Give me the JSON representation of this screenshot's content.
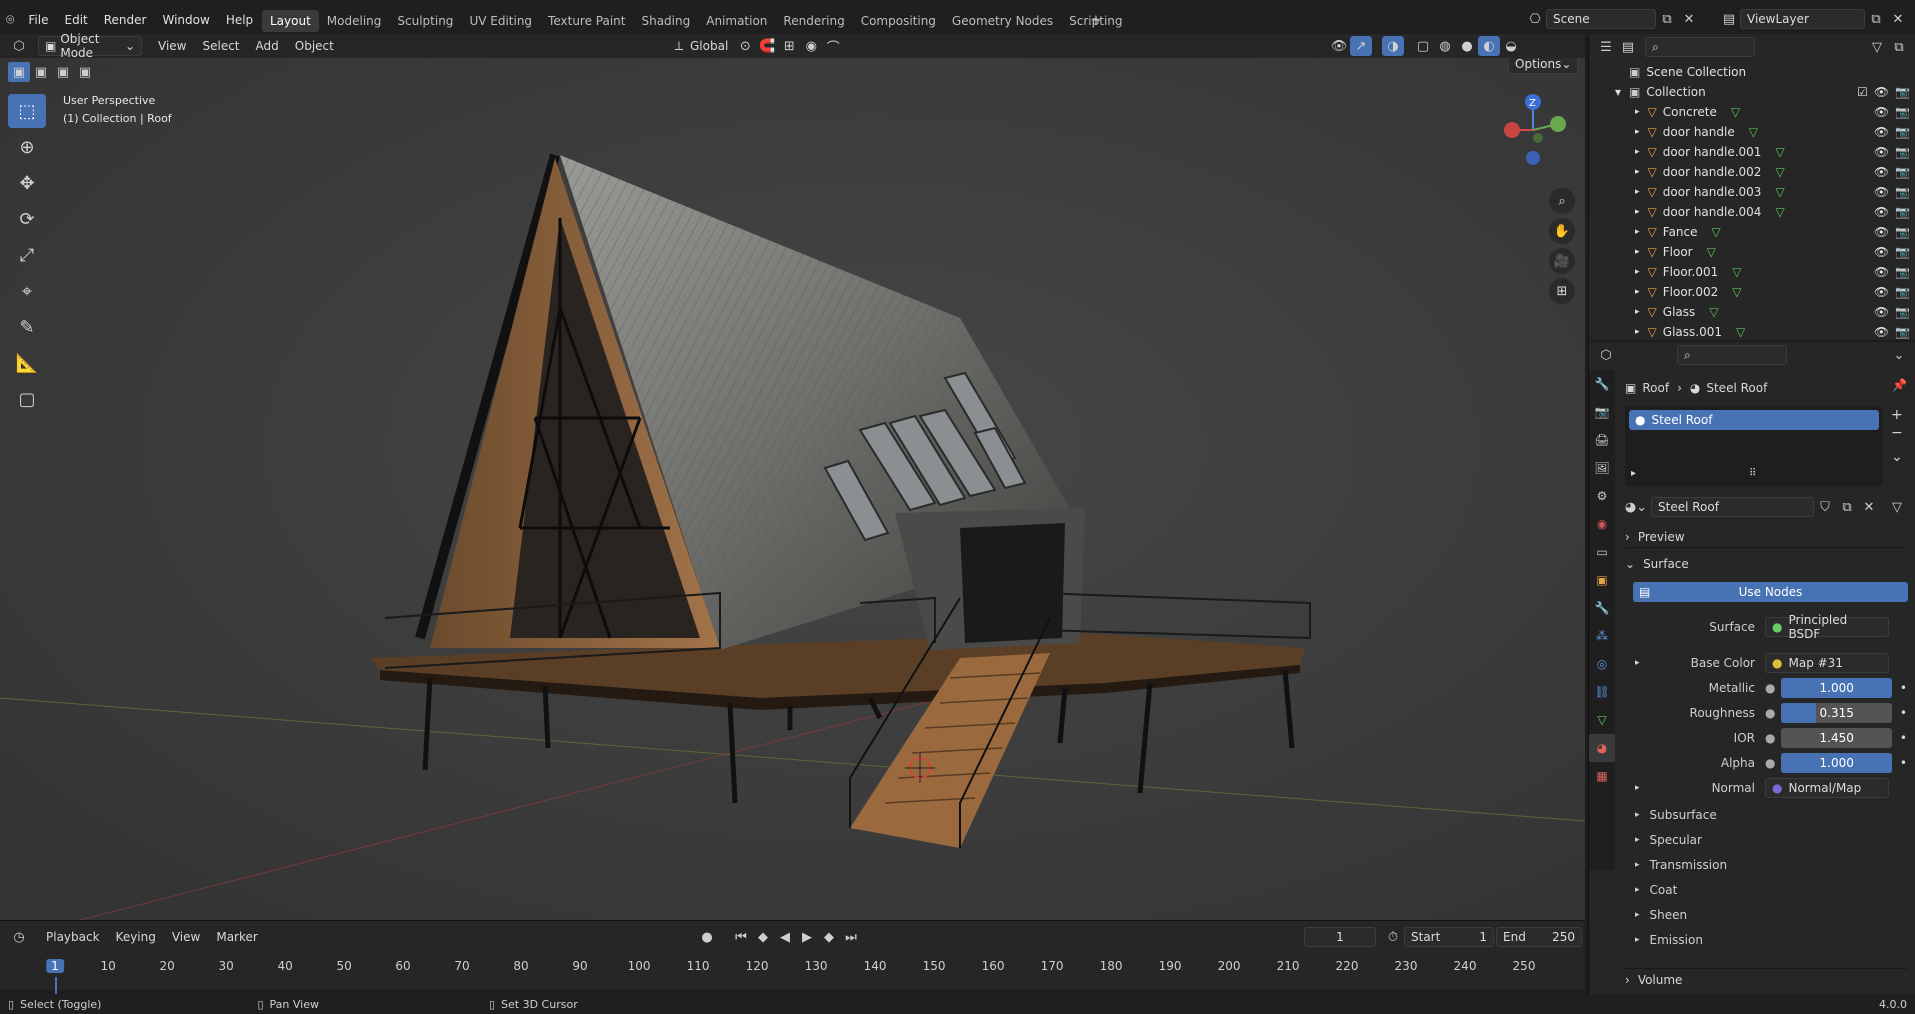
{
  "app": {
    "version": "4.0.0"
  },
  "menu": [
    "File",
    "Edit",
    "Render",
    "Window",
    "Help"
  ],
  "workspaces": [
    "Layout",
    "Modeling",
    "Sculpting",
    "UV Editing",
    "Texture Paint",
    "Shading",
    "Animation",
    "Rendering",
    "Compositing",
    "Geometry Nodes",
    "Scripting"
  ],
  "active_workspace": "Layout",
  "scene": {
    "name": "Scene",
    "view_layer": "ViewLayer"
  },
  "viewport_header": {
    "mode": "Object Mode",
    "menus": [
      "View",
      "Select",
      "Add",
      "Object"
    ],
    "orientation": "Global",
    "options": "Options"
  },
  "viewport": {
    "overlay_line1": "User Perspective",
    "overlay_line2": "(1) Collection | Roof",
    "gizmo_icons": [
      "zoom-icon",
      "hand-icon",
      "camera-icon",
      "grid-icon"
    ]
  },
  "outliner": {
    "scene_collection": "Scene Collection",
    "collection": "Collection",
    "items": [
      "Concrete",
      "door handle",
      "door handle.001",
      "door handle.002",
      "door handle.003",
      "door handle.004",
      "Fance",
      "Floor",
      "Floor.001",
      "Floor.002",
      "Glass",
      "Glass.001"
    ]
  },
  "properties": {
    "breadcrumb_object": "Roof",
    "breadcrumb_material": "Steel Roof",
    "slot_name": "Steel Roof",
    "material_name": "Steel Roof",
    "panel_preview": "Preview",
    "panel_surface": "Surface",
    "use_nodes": "Use Nodes",
    "surface_label": "Surface",
    "surface_value": "Principled BSDF",
    "base_color_label": "Base Color",
    "base_color_value": "Map #31",
    "metallic_label": "Metallic",
    "metallic_value": "1.000",
    "metallic_fill": 1.0,
    "roughness_label": "Roughness",
    "roughness_value": "0.315",
    "roughness_fill": 0.315,
    "ior_label": "IOR",
    "ior_value": "1.450",
    "alpha_label": "Alpha",
    "alpha_value": "1.000",
    "alpha_fill": 1.0,
    "normal_label": "Normal",
    "normal_value": "Normal/Map",
    "subpanels": [
      "Subsurface",
      "Specular",
      "Transmission",
      "Coat",
      "Sheen",
      "Emission"
    ],
    "volume": "Volume"
  },
  "timeline": {
    "menus": [
      "Playback",
      "Keying",
      "View",
      "Marker"
    ],
    "current_frame": "1",
    "start_label": "Start",
    "start_value": "1",
    "end_label": "End",
    "end_value": "250",
    "ticks": [
      "1",
      "10",
      "20",
      "30",
      "40",
      "50",
      "60",
      "70",
      "80",
      "90",
      "100",
      "110",
      "120",
      "130",
      "140",
      "150",
      "160",
      "170",
      "180",
      "190",
      "200",
      "210",
      "220",
      "230",
      "240",
      "250"
    ]
  },
  "statusbar": {
    "select": "Select (Toggle)",
    "pan": "Pan View",
    "cursor": "Set 3D Cursor",
    "version": "4.0.0"
  },
  "colors": {
    "accent": "#4772b3",
    "viewport_bg": "#3d3d3d",
    "panel_bg": "#262626"
  }
}
